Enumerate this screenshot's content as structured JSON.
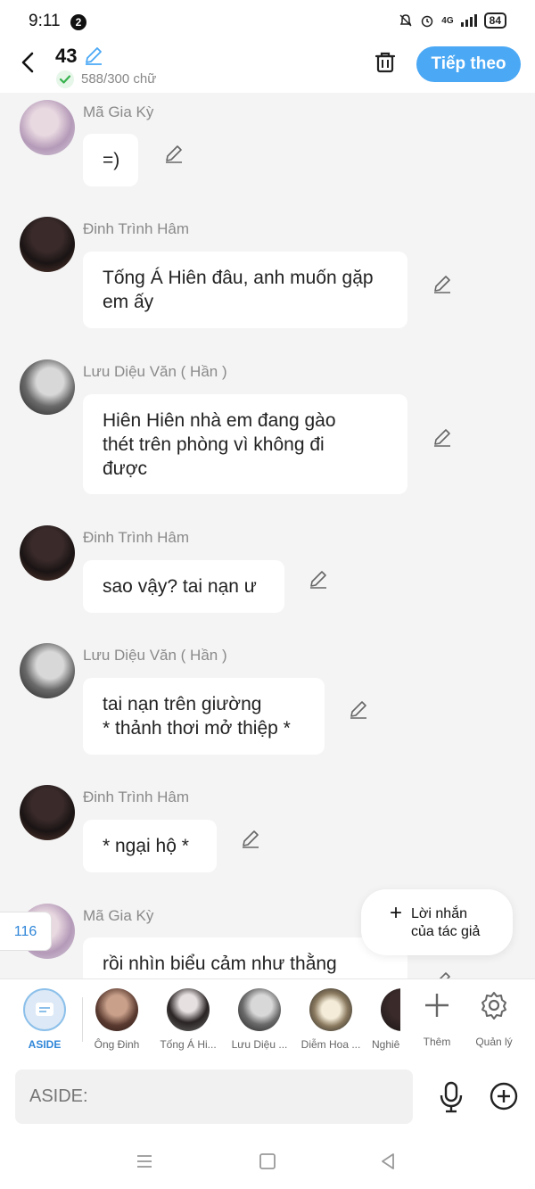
{
  "status_bar": {
    "time": "9:11",
    "notification_count": "2",
    "signal": "4G",
    "battery": "84"
  },
  "header": {
    "chapter_number": "43",
    "word_count": "588/300 chữ",
    "next_label": "Tiếp theo"
  },
  "messages": [
    {
      "name": "Mã Gia Kỳ",
      "lines": [
        "=)"
      ]
    },
    {
      "name": "Đinh Trình Hâm",
      "lines": [
        "Tống Á Hiên đâu, anh muốn gặp",
        "em ấy"
      ]
    },
    {
      "name": "Lưu Diệu Văn ( Hần )",
      "lines": [
        "Hiên Hiên nhà em đang gào",
        "thét trên phòng vì không đi",
        "được"
      ]
    },
    {
      "name": "Đinh Trình Hâm",
      "lines": [
        "sao vậy? tai nạn ư"
      ]
    },
    {
      "name": "Lưu Diệu Văn ( Hần )",
      "lines": [
        "tai nạn trên giường",
        "* thảnh thơi mở thiệp *"
      ]
    },
    {
      "name": "Đinh Trình Hâm",
      "lines": [
        "* ngại hộ *"
      ]
    },
    {
      "name": "Mã Gia Kỳ",
      "lines": [
        "rồi nhìn biểu cảm như thằng"
      ]
    }
  ],
  "message_count_badge": "116",
  "author_note": {
    "label_line1": "Lời nhắn",
    "label_line2": "của tác giả"
  },
  "characters": [
    {
      "name": "ASIDE"
    },
    {
      "name": "Ông Đinh"
    },
    {
      "name": "Tống Á Hi..."
    },
    {
      "name": "Lưu Diệu ..."
    },
    {
      "name": "Diễm Hoa ..."
    },
    {
      "name": "Nghiê"
    }
  ],
  "tools": {
    "add": "Thêm",
    "manage": "Quản lý"
  },
  "composer": {
    "placeholder": "ASIDE:"
  },
  "colors": {
    "accent": "#4aa8f5",
    "background": "#f4f4f4"
  }
}
